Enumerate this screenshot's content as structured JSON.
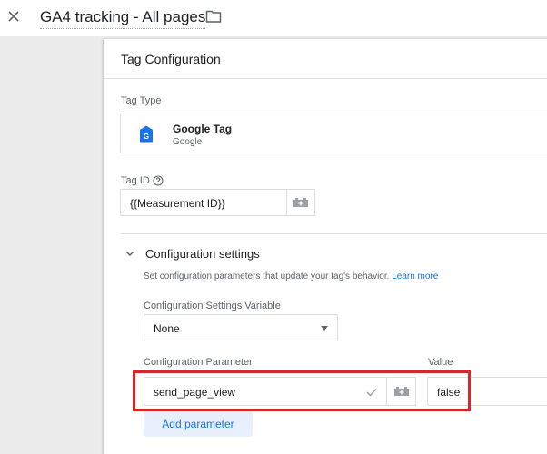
{
  "header": {
    "title": "GA4 tracking - All pages",
    "close_icon": "close-icon",
    "folder_icon": "folder-icon"
  },
  "panel": {
    "title": "Tag Configuration",
    "tag_type": {
      "label": "Tag Type",
      "name": "Google Tag",
      "vendor": "Google",
      "icon": "google-tag-icon"
    },
    "tag_id": {
      "label": "Tag ID",
      "value": "{{Measurement ID}}",
      "help_icon": "help-icon",
      "variable_icon": "variable-picker-icon"
    },
    "config_settings": {
      "title": "Configuration settings",
      "description": "Set configuration parameters that update your tag's behavior.",
      "learn_more": "Learn more",
      "variable_label": "Configuration Settings Variable",
      "variable_selected": "None",
      "param_header": "Configuration Parameter",
      "value_header": "Value",
      "rows": [
        {
          "parameter": "send_page_view",
          "value": "false"
        }
      ],
      "add_parameter": "Add parameter"
    }
  },
  "colors": {
    "accent": "#1a73e8",
    "highlight_border": "#d62828",
    "tag_icon": "#1a73e8"
  }
}
